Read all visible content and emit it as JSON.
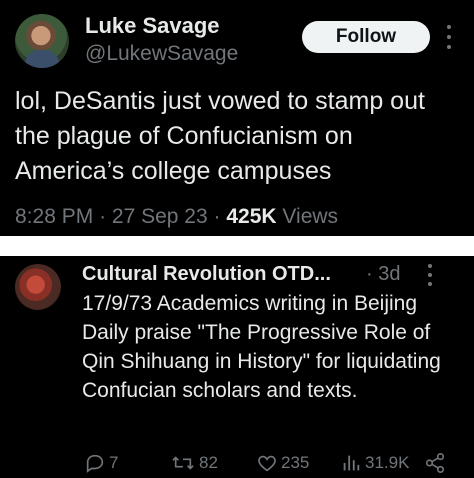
{
  "tweet_main": {
    "author_name": "Luke Savage",
    "handle": "@LukewSavage",
    "follow_label": "Follow",
    "text": "lol, DeSantis just vowed to stamp out the plague of Confucianism on America’s college campuses",
    "time": "8:28 PM",
    "date": "27 Sep 23",
    "separator": "·",
    "views_count": "425K",
    "views_label": "Views"
  },
  "tweet_quoted": {
    "author_name": "Cultural Revolution OTD...",
    "separator": "·",
    "age": "3d",
    "text": "17/9/73 Academics writing in Beijing Daily praise \"The Progressive Role of Qin Shihuang in History\" for liquidating Confucian scholars and texts.",
    "replies": "7",
    "retweets": "82",
    "likes": "235",
    "views": "31.9K"
  },
  "icons": [
    "more-icon",
    "reply-icon",
    "retweet-icon",
    "like-icon",
    "views-icon",
    "share-icon"
  ],
  "colors": {
    "background": "#000000",
    "text": "#e7e9ea",
    "muted": "#71767b",
    "follow_bg": "#eff3f4",
    "separator": "#ffffff"
  }
}
